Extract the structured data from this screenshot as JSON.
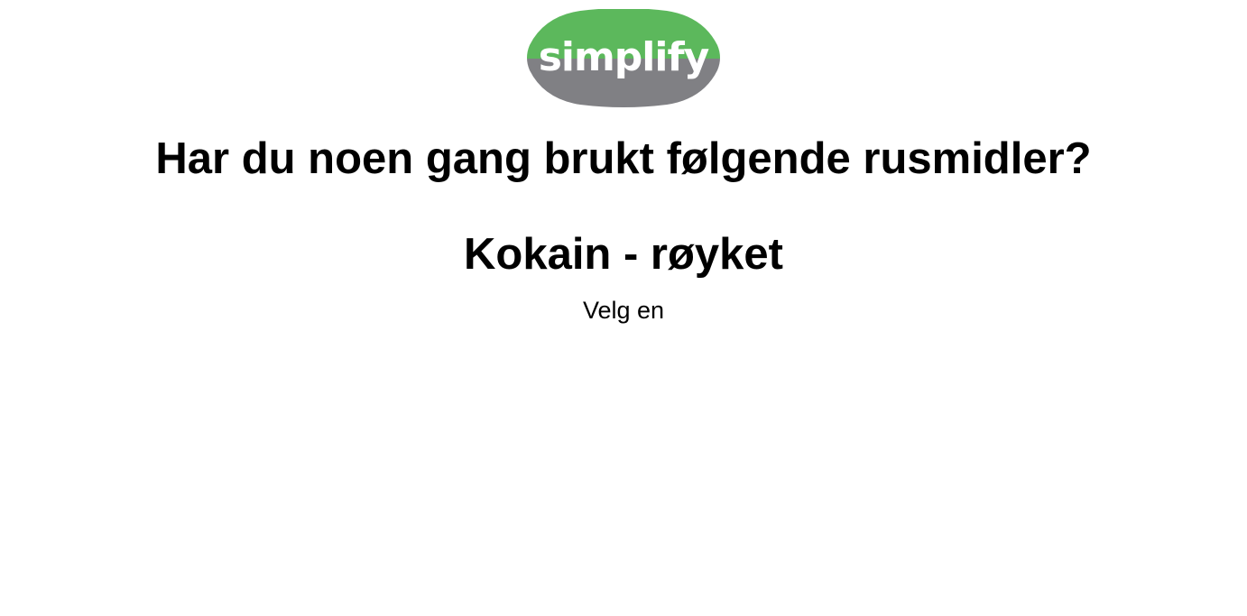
{
  "logo": {
    "text": "simplify",
    "colors": {
      "top": "#5cb85c",
      "bottom": "#808084",
      "text": "#ffffff"
    }
  },
  "question": {
    "title": "Har du noen gang brukt følgende rusmidler?",
    "substance": "Kokain - røyket",
    "instruction": "Velg en"
  }
}
